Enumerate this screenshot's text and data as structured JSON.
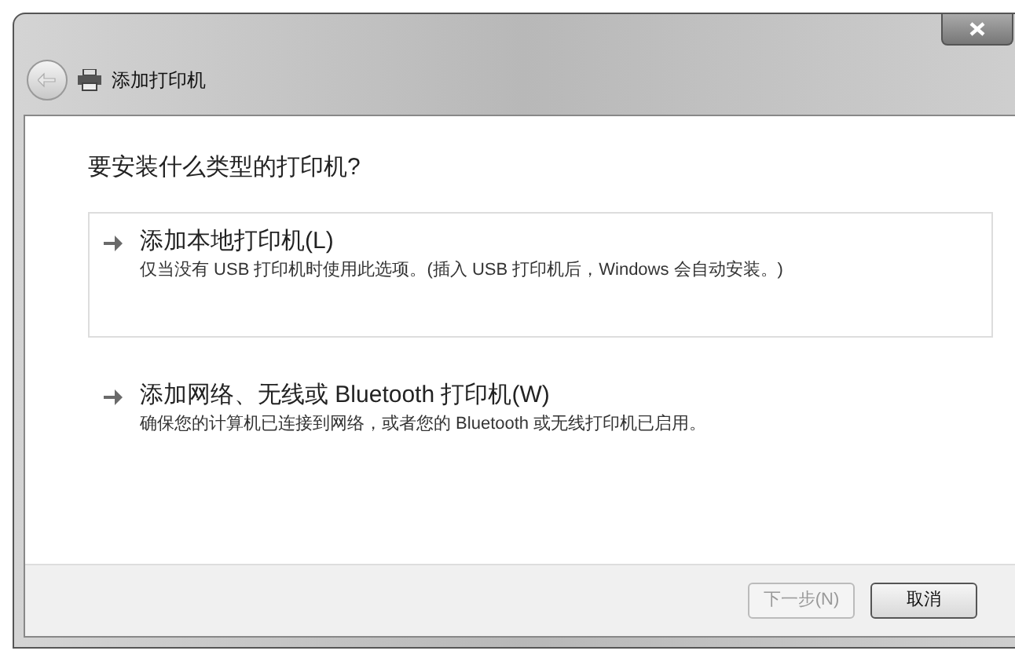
{
  "window": {
    "title": "添加打印机"
  },
  "heading": "要安装什么类型的打印机?",
  "options": [
    {
      "label": "添加本地打印机(L)",
      "description": "仅当没有 USB 打印机时使用此选项。(插入 USB 打印机后，Windows 会自动安装。)",
      "selected": true
    },
    {
      "label": "添加网络、无线或 Bluetooth 打印机(W)",
      "description": "确保您的计算机已连接到网络，或者您的 Bluetooth 或无线打印机已启用。",
      "selected": false
    }
  ],
  "buttons": [
    {
      "label": "下一步(N)",
      "disabled": true
    },
    {
      "label": "取消",
      "disabled": false
    }
  ]
}
